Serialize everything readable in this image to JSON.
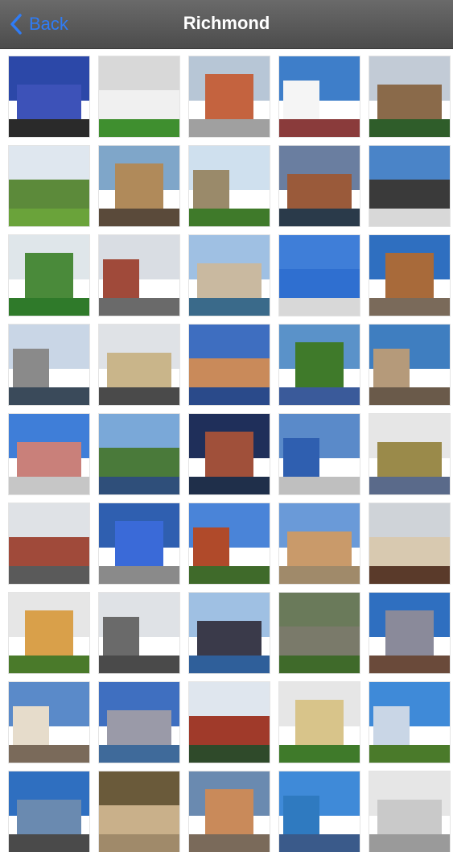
{
  "navbar": {
    "back_label": "Back",
    "title": "Richmond",
    "accent": "#2f7cf6",
    "background": "#555555"
  },
  "gallery": {
    "columns": 5,
    "tiles": [
      {
        "sky": "#2c48a8",
        "bld": "#3d52b8",
        "ground": "#2a2a2a"
      },
      {
        "sky": "#d8d8d8",
        "bld": "#f0f0f0",
        "ground": "#3f8f2f"
      },
      {
        "sky": "#b7c6d6",
        "bld": "#c4633f",
        "ground": "#a0a0a0"
      },
      {
        "sky": "#3e7ec9",
        "bld": "#f5f5f5",
        "ground": "#8a3b3b"
      },
      {
        "sky": "#c2cbd6",
        "bld": "#8a6a4a",
        "ground": "#2f5d2a"
      },
      {
        "sky": "#dfe7ef",
        "bld": "#5c8a3a",
        "ground": "#6aa33a"
      },
      {
        "sky": "#7fa6c9",
        "bld": "#b08a5a",
        "ground": "#5a4a3a"
      },
      {
        "sky": "#cfe0ee",
        "bld": "#9a8a6a",
        "ground": "#3f7a2a"
      },
      {
        "sky": "#6a7ea0",
        "bld": "#9a5a3a",
        "ground": "#2a3a4a"
      },
      {
        "sky": "#4a84c8",
        "bld": "#3a3a3a",
        "ground": "#d8d8d8"
      },
      {
        "sky": "#dfe6ea",
        "bld": "#4a8a3a",
        "ground": "#2f7a2a"
      },
      {
        "sky": "#d9dde3",
        "bld": "#a04a3a",
        "ground": "#6a6a6a"
      },
      {
        "sky": "#9fc0e3",
        "bld": "#c9b9a0",
        "ground": "#3a6a8a"
      },
      {
        "sky": "#3f7ed8",
        "bld": "#2f6fd0",
        "ground": "#d8d8d8"
      },
      {
        "sky": "#2f6fc0",
        "bld": "#a86a3a",
        "ground": "#7a6a5a"
      },
      {
        "sky": "#c9d6e6",
        "bld": "#8a8a8a",
        "ground": "#3a4a5a"
      },
      {
        "sky": "#dfe2e6",
        "bld": "#c9b58a",
        "ground": "#4a4a4a"
      },
      {
        "sky": "#3e6ec0",
        "bld": "#c98a5a",
        "ground": "#2a4a8a"
      },
      {
        "sky": "#5a92c9",
        "bld": "#3f7a2a",
        "ground": "#3a5a9a"
      },
      {
        "sky": "#3f7ec0",
        "bld": "#b59a7a",
        "ground": "#6a5a4a"
      },
      {
        "sky": "#3f7ed8",
        "bld": "#c9807a",
        "ground": "#c6c6c6"
      },
      {
        "sky": "#7aa8d8",
        "bld": "#4a7a3a",
        "ground": "#2f4f7a"
      },
      {
        "sky": "#1f2f5a",
        "bld": "#a0503a",
        "ground": "#1f2f4a"
      },
      {
        "sky": "#5a8ac9",
        "bld": "#2f5fb0",
        "ground": "#bfbfbf"
      },
      {
        "sky": "#e6e6e6",
        "bld": "#9a8a4a",
        "ground": "#5a6a8a"
      },
      {
        "sky": "#dfe2e6",
        "bld": "#a04a3a",
        "ground": "#5a5a5a"
      },
      {
        "sky": "#2f5fb0",
        "bld": "#3a6ad8",
        "ground": "#8a8a8a"
      },
      {
        "sky": "#4a84d8",
        "bld": "#b04a2a",
        "ground": "#3f6a2a"
      },
      {
        "sky": "#6a9ad8",
        "bld": "#c99a6a",
        "ground": "#a08a6a"
      },
      {
        "sky": "#cfd3d8",
        "bld": "#d8c9b0",
        "ground": "#5a3a2a"
      },
      {
        "sky": "#e6e6e6",
        "bld": "#d9a04a",
        "ground": "#4a7a2a"
      },
      {
        "sky": "#dfe2e6",
        "bld": "#6a6a6a",
        "ground": "#4a4a4a"
      },
      {
        "sky": "#9fc0e3",
        "bld": "#3a3a4a",
        "ground": "#2f5f9a"
      },
      {
        "sky": "#6a7a5a",
        "bld": "#7a7a6a",
        "ground": "#3f6a2a"
      },
      {
        "sky": "#2f6fc0",
        "bld": "#8a8a9a",
        "ground": "#6a4a3a"
      },
      {
        "sky": "#5a8ac9",
        "bld": "#e6dccb",
        "ground": "#7a6a5a"
      },
      {
        "sky": "#3f6fc0",
        "bld": "#9a9aa8",
        "ground": "#3f6a9a"
      },
      {
        "sky": "#dfe6ee",
        "bld": "#a03a2a",
        "ground": "#2f4a2a"
      },
      {
        "sky": "#e6e6e6",
        "bld": "#d8c48a",
        "ground": "#3f7a2a"
      },
      {
        "sky": "#3f8ad8",
        "bld": "#c9d6e6",
        "ground": "#4a7a2a"
      },
      {
        "sky": "#2f6fc0",
        "bld": "#6a8ab0",
        "ground": "#4a4a4a"
      },
      {
        "sky": "#6a5a3a",
        "bld": "#c9b08a",
        "ground": "#a08a6a"
      },
      {
        "sky": "#6a8ab0",
        "bld": "#c98a5a",
        "ground": "#7a6a5a"
      },
      {
        "sky": "#3f8ad8",
        "bld": "#2f7ac0",
        "ground": "#3a5a8a"
      },
      {
        "sky": "#e6e6e6",
        "bld": "#c9c9c9",
        "ground": "#9a9a9a"
      }
    ]
  }
}
